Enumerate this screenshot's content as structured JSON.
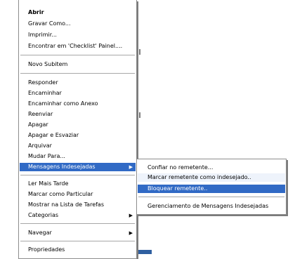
{
  "main_menu": {
    "items": [
      {
        "label": "Abrir"
      },
      {
        "label": "Gravar Como..."
      },
      {
        "label": "Imprimir..."
      },
      {
        "label": "Encontrar em 'Checklist' Painel...."
      },
      {
        "label": "Novo Subitem"
      },
      {
        "label": "Responder"
      },
      {
        "label": "Encaminhar"
      },
      {
        "label": "Encaminhar como Anexo"
      },
      {
        "label": "Reenviar"
      },
      {
        "label": "Apagar"
      },
      {
        "label": "Apagar e Esvaziar"
      },
      {
        "label": "Arquivar"
      },
      {
        "label": "Mudar Para..."
      },
      {
        "label": "Mensagens Indesejadas"
      },
      {
        "label": "Ler Mais Tarde"
      },
      {
        "label": "Marcar como Particular"
      },
      {
        "label": "Mostrar na Lista de Tarefas"
      },
      {
        "label": "Categorias"
      },
      {
        "label": "Navegar"
      },
      {
        "label": "Propriedades"
      }
    ]
  },
  "sub_menu": {
    "items": [
      {
        "label": "Confiar no remetente..."
      },
      {
        "label": "Marcar remetente como indesejado.."
      },
      {
        "label": "Bloquear remetente.."
      },
      {
        "label": "Gerenciamento de Mensagens Indesejadas"
      }
    ]
  },
  "icons": {
    "submenu_arrow": "chevron-right-icon"
  },
  "colors": {
    "highlight": "#316ac5",
    "highlight_text": "#ffffff"
  }
}
